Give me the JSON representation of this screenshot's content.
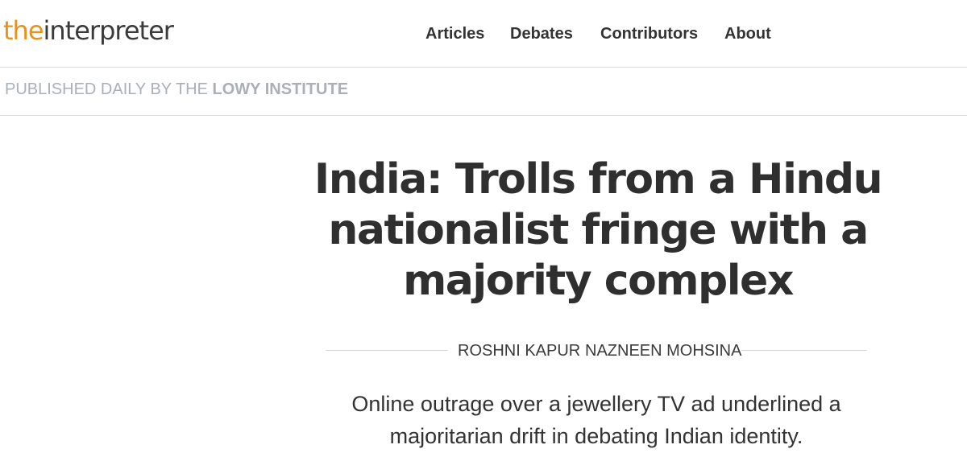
{
  "site": {
    "logo_the": "the",
    "logo_interpreter": "interpreter",
    "brand_color": "#e8921c"
  },
  "nav": {
    "items": [
      {
        "label": "Articles"
      },
      {
        "label": "Debates"
      },
      {
        "label": "Contributors"
      },
      {
        "label": "About"
      }
    ]
  },
  "tagline": {
    "prefix": "PUBLISHED DAILY BY THE ",
    "institute": "LOWY INSTITUTE",
    "color": "#a9b0b6"
  },
  "article": {
    "headline": "India: Trolls from a Hindu nationalist fringe with a majority complex",
    "authors": [
      "ROSHNI KAPUR",
      "NAZNEEN MOHSINA"
    ],
    "standfirst": "Online outrage over a jewellery TV ad underlined a majoritarian drift in debating Indian identity."
  }
}
